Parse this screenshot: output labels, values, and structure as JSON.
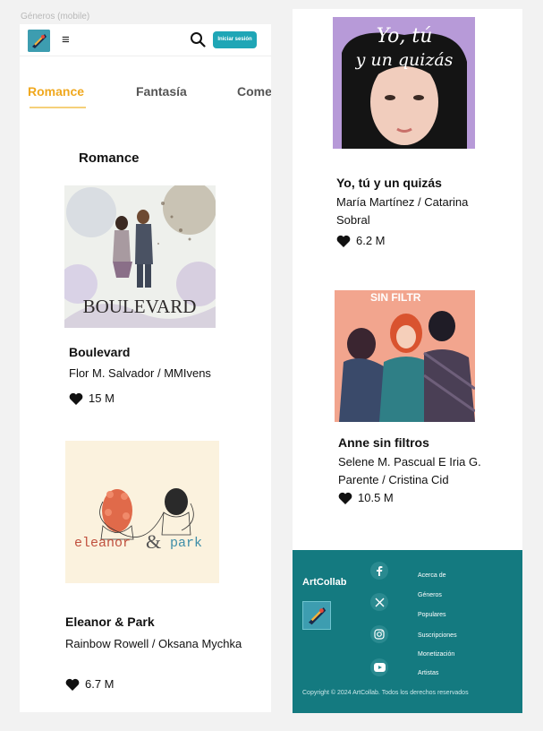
{
  "frame_label": "Géneros (mobile)",
  "header": {
    "logo_icon": "artcollab-logo-icon",
    "menu_icon": "≡",
    "search_icon": "search-icon",
    "login_label": "Iniciar sesión"
  },
  "tabs": [
    {
      "label": "Romance",
      "active": true
    },
    {
      "label": "Fantasía",
      "active": false
    },
    {
      "label": "Come",
      "active": false
    }
  ],
  "section_title": "Romance",
  "books_left": [
    {
      "title": "Boulevard",
      "author": "Flor M. Salvador / MMIvens",
      "likes": "15 M",
      "cover_text": "BOULEVARD"
    },
    {
      "title": "Eleanor & Park",
      "author": "Rainbow Rowell / Oksana Mychka",
      "likes": "6.7 M",
      "cover_text_1": "eleanor",
      "cover_text_2": "park"
    }
  ],
  "books_right": [
    {
      "title": "Yo, tú y un quizás",
      "author": "María Martínez / Catarina Sobral",
      "likes": "6.2 M",
      "cover_text_1": "Yo, tú",
      "cover_text_2": "y un quizás"
    },
    {
      "title": "Anne sin filtros",
      "author": "Selene M. Pascual E Iria G. Parente / Cristina Cid",
      "likes": "10.5 M",
      "cover_text": "SIN FILTR"
    }
  ],
  "footer": {
    "brand": "ArtCollab",
    "social": [
      "facebook-icon",
      "x-icon",
      "instagram-icon",
      "youtube-icon"
    ],
    "links": [
      "Acerca de",
      "Géneros",
      "Populares",
      "Suscripciones",
      "Monetización",
      "Artistas"
    ],
    "copyright": "Copyright © 2024 ArtCollab.  Todos los derechos reservados"
  },
  "colors": {
    "accent": "#f0a81e",
    "button": "#1fa6b6",
    "footer": "#147a80"
  }
}
